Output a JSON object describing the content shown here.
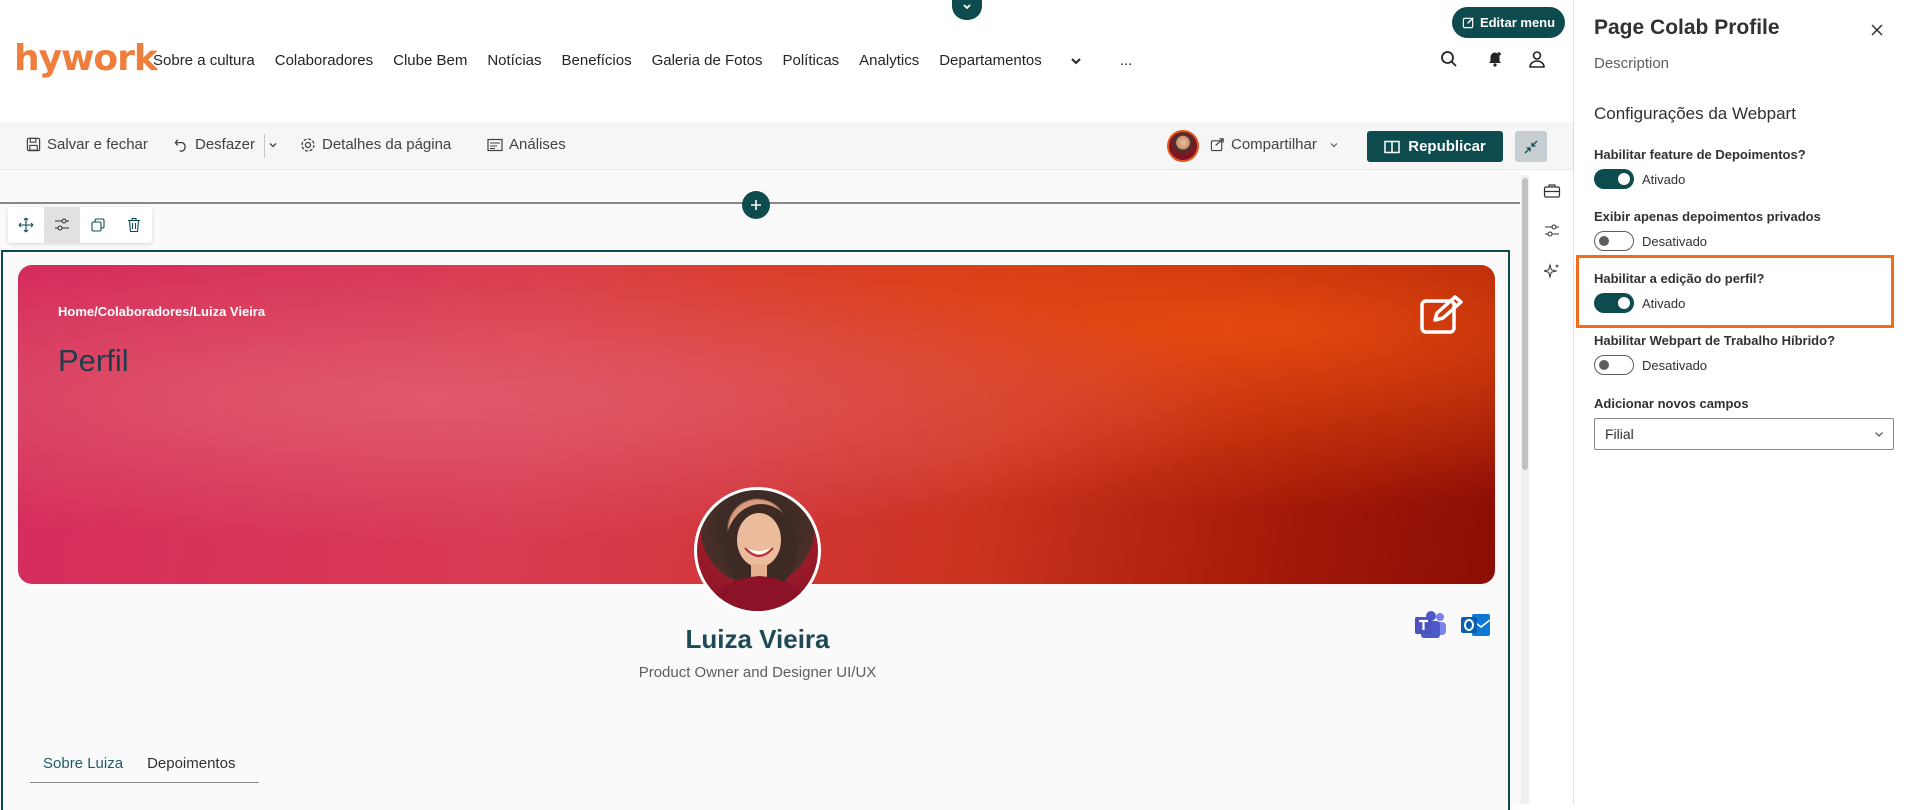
{
  "header": {
    "logo": "hywork",
    "nav": [
      "Sobre a cultura",
      "Colaboradores",
      "Clube Bem",
      "Notícias",
      "Benefícios",
      "Galeria de Fotos",
      "Políticas",
      "Analytics",
      "Departamentos",
      "..."
    ],
    "edit_menu": "Editar menu"
  },
  "commandbar": {
    "save_close": "Salvar e fechar",
    "undo": "Desfazer",
    "page_details": "Detalhes da página",
    "analytics": "Análises",
    "share": "Compartilhar",
    "republish": "Republicar"
  },
  "profile": {
    "breadcrumb": "Home/Colaboradores/Luiza Vieira",
    "title": "Perfil",
    "name": "Luiza Vieira",
    "role": "Product Owner and Designer UI/UX",
    "tabs": [
      "Sobre Luiza",
      "Depoimentos"
    ]
  },
  "pane": {
    "title": "Page Colab Profile",
    "description": "Description",
    "group": "Configurações da Webpart",
    "fields": [
      {
        "label": "Habilitar feature de Depoimentos?",
        "state": "Ativado",
        "on": true
      },
      {
        "label": "Exibir apenas depoimentos privados",
        "state": "Desativado",
        "on": false
      },
      {
        "label": "Habilitar a edição do perfil?",
        "state": "Ativado",
        "on": true
      },
      {
        "label": "Habilitar Webpart de Trabalho Híbrido?",
        "state": "Desativado",
        "on": false
      }
    ],
    "new_fields_label": "Adicionar novos campos",
    "new_fields_value": "Filial"
  },
  "colors": {
    "brand_teal": "#0d4b4f",
    "brand_orange": "#ef7d3b",
    "highlight": "#f36b1c"
  }
}
